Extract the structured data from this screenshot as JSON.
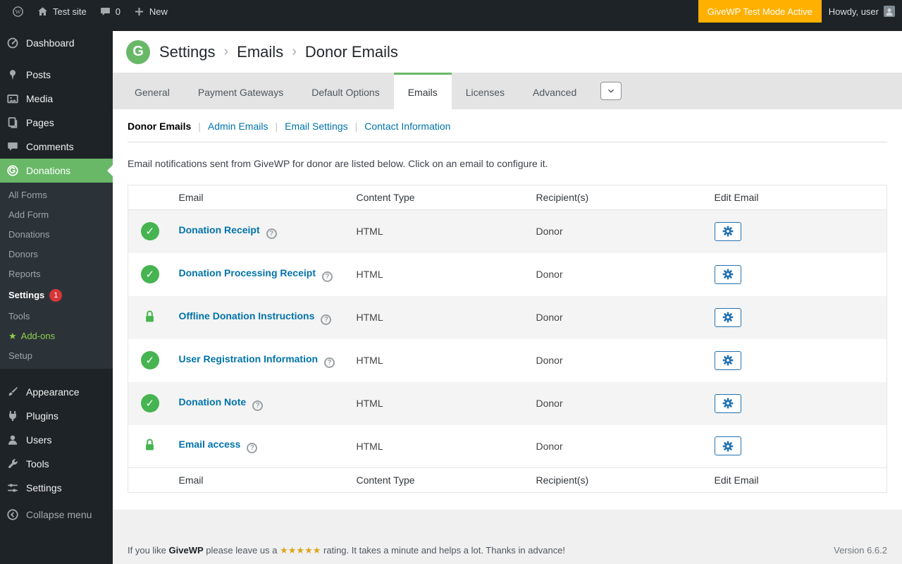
{
  "colors": {
    "brand_green": "#69b868",
    "check_green": "#46b450",
    "link_blue": "#0073aa",
    "button_blue": "#2271b1",
    "badge_red": "#d63638",
    "test_mode_bg": "#ffb000",
    "addons_green": "#8fce4e",
    "stars_gold": "#dba617"
  },
  "admin_bar": {
    "site_name": "Test site",
    "comment_count": "0",
    "new_label": "New",
    "test_mode_label": "GiveWP Test Mode Active",
    "greeting": "Howdy, user"
  },
  "sidebar": {
    "top_items": [
      {
        "label": "Dashboard"
      },
      {
        "label": "Posts"
      },
      {
        "label": "Media"
      },
      {
        "label": "Pages"
      },
      {
        "label": "Comments"
      },
      {
        "label": "Donations"
      }
    ],
    "donations_submenu": [
      {
        "label": "All Forms"
      },
      {
        "label": "Add Form"
      },
      {
        "label": "Donations"
      },
      {
        "label": "Donors"
      },
      {
        "label": "Reports"
      },
      {
        "label": "Settings",
        "badge": "1"
      },
      {
        "label": "Tools"
      },
      {
        "label": "Add-ons",
        "star": "★"
      },
      {
        "label": "Setup"
      }
    ],
    "bottom_items": [
      {
        "label": "Appearance"
      },
      {
        "label": "Plugins"
      },
      {
        "label": "Users"
      },
      {
        "label": "Tools"
      },
      {
        "label": "Settings"
      }
    ],
    "collapse_label": "Collapse menu"
  },
  "header": {
    "logo_letter": "G",
    "separator": "›",
    "breadcrumb": [
      {
        "label": "Settings"
      },
      {
        "label": "Emails"
      },
      {
        "label": "Donor Emails"
      }
    ]
  },
  "tabs": [
    {
      "label": "General"
    },
    {
      "label": "Payment Gateways"
    },
    {
      "label": "Default Options"
    },
    {
      "label": "Emails",
      "active": true
    },
    {
      "label": "Licenses"
    },
    {
      "label": "Advanced"
    }
  ],
  "subnav": {
    "separator": "|",
    "items": [
      {
        "label": "Donor Emails",
        "current": true
      },
      {
        "label": "Admin Emails"
      },
      {
        "label": "Email Settings"
      },
      {
        "label": "Contact Information"
      }
    ]
  },
  "description": "Email notifications sent from GiveWP for donor are listed below. Click on an email to configure it.",
  "table": {
    "check_glyph": "✓",
    "help_glyph": "?",
    "headers": {
      "email": "Email",
      "content_type": "Content Type",
      "recipients": "Recipient(s)",
      "edit": "Edit Email"
    },
    "rows": [
      {
        "status": "enabled",
        "name": "Donation Receipt",
        "content_type": "HTML",
        "recipients": "Donor"
      },
      {
        "status": "enabled",
        "name": "Donation Processing Receipt",
        "content_type": "HTML",
        "recipients": "Donor"
      },
      {
        "status": "locked",
        "name": "Offline Donation Instructions",
        "content_type": "HTML",
        "recipients": "Donor"
      },
      {
        "status": "enabled",
        "name": "User Registration Information",
        "content_type": "HTML",
        "recipients": "Donor"
      },
      {
        "status": "enabled",
        "name": "Donation Note",
        "content_type": "HTML",
        "recipients": "Donor"
      },
      {
        "status": "locked",
        "name": "Email access",
        "content_type": "HTML",
        "recipients": "Donor"
      }
    ]
  },
  "footer": {
    "text_before_brand": "If you like",
    "brand": "GiveWP",
    "text_after_brand": "please leave us a",
    "stars": "★★★★★",
    "text_after_stars": "rating. It takes a minute and helps a lot. Thanks in advance!",
    "version": "Version 6.6.2"
  }
}
